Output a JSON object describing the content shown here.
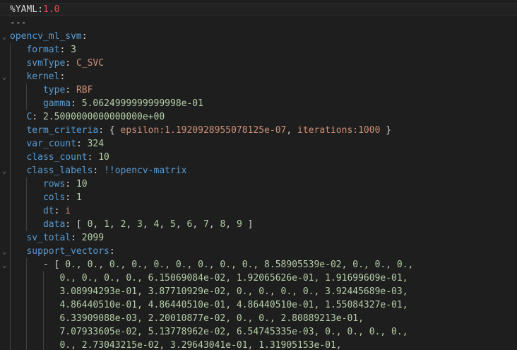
{
  "theme": {
    "background": "#1e1e1e",
    "key": "#569cd6",
    "number": "#b5cea8",
    "string": "#ce9178",
    "version": "#f44747",
    "text": "#d4d4d4"
  },
  "lines": [
    {
      "indent": 0,
      "fold": false,
      "active": true,
      "tokens": [
        {
          "t": "%YAML",
          "c": "directive"
        },
        {
          "t": ":",
          "c": "plain"
        },
        {
          "t": "1.0",
          "c": "version"
        }
      ]
    },
    {
      "indent": 0,
      "fold": false,
      "tokens": [
        {
          "t": "---",
          "c": "plain"
        }
      ]
    },
    {
      "indent": 0,
      "fold": true,
      "tokens": [
        {
          "t": "opencv_ml_svm",
          "c": "key"
        },
        {
          "t": ":",
          "c": "plain"
        }
      ]
    },
    {
      "indent": 1,
      "fold": false,
      "tokens": [
        {
          "t": "format",
          "c": "key"
        },
        {
          "t": ": ",
          "c": "plain"
        },
        {
          "t": "3",
          "c": "num"
        }
      ]
    },
    {
      "indent": 1,
      "fold": false,
      "tokens": [
        {
          "t": "svmType",
          "c": "key"
        },
        {
          "t": ": ",
          "c": "plain"
        },
        {
          "t": "C_SVC",
          "c": "str"
        }
      ]
    },
    {
      "indent": 1,
      "fold": true,
      "tokens": [
        {
          "t": "kernel",
          "c": "key"
        },
        {
          "t": ":",
          "c": "plain"
        }
      ]
    },
    {
      "indent": 2,
      "fold": false,
      "tokens": [
        {
          "t": "type",
          "c": "key"
        },
        {
          "t": ": ",
          "c": "plain"
        },
        {
          "t": "RBF",
          "c": "str"
        }
      ]
    },
    {
      "indent": 2,
      "fold": false,
      "tokens": [
        {
          "t": "gamma",
          "c": "key"
        },
        {
          "t": ": ",
          "c": "plain"
        },
        {
          "t": "5.0624999999999998e-01",
          "c": "num"
        }
      ]
    },
    {
      "indent": 1,
      "fold": false,
      "tokens": [
        {
          "t": "C",
          "c": "key"
        },
        {
          "t": ": ",
          "c": "plain"
        },
        {
          "t": "2.5000000000000000e+00",
          "c": "num"
        }
      ]
    },
    {
      "indent": 1,
      "fold": false,
      "tokens": [
        {
          "t": "term_criteria",
          "c": "key"
        },
        {
          "t": ": { ",
          "c": "plain"
        },
        {
          "t": "epsilon:1.1920928955078125e-07",
          "c": "str"
        },
        {
          "t": ", ",
          "c": "plain"
        },
        {
          "t": "iterations:1000",
          "c": "str"
        },
        {
          "t": " }",
          "c": "plain"
        }
      ]
    },
    {
      "indent": 1,
      "fold": false,
      "tokens": [
        {
          "t": "var_count",
          "c": "key"
        },
        {
          "t": ": ",
          "c": "plain"
        },
        {
          "t": "324",
          "c": "num"
        }
      ]
    },
    {
      "indent": 1,
      "fold": false,
      "tokens": [
        {
          "t": "class_count",
          "c": "key"
        },
        {
          "t": ": ",
          "c": "plain"
        },
        {
          "t": "10",
          "c": "num"
        }
      ]
    },
    {
      "indent": 1,
      "fold": true,
      "tokens": [
        {
          "t": "class_labels",
          "c": "key"
        },
        {
          "t": ": ",
          "c": "plain"
        },
        {
          "t": "!!opencv-matrix",
          "c": "tag"
        }
      ]
    },
    {
      "indent": 2,
      "fold": false,
      "tokens": [
        {
          "t": "rows",
          "c": "key"
        },
        {
          "t": ": ",
          "c": "plain"
        },
        {
          "t": "10",
          "c": "num"
        }
      ]
    },
    {
      "indent": 2,
      "fold": false,
      "tokens": [
        {
          "t": "cols",
          "c": "key"
        },
        {
          "t": ": ",
          "c": "plain"
        },
        {
          "t": "1",
          "c": "num"
        }
      ]
    },
    {
      "indent": 2,
      "fold": false,
      "tokens": [
        {
          "t": "dt",
          "c": "key"
        },
        {
          "t": ": ",
          "c": "plain"
        },
        {
          "t": "i",
          "c": "str"
        }
      ]
    },
    {
      "indent": 2,
      "fold": false,
      "tokens": [
        {
          "t": "data",
          "c": "key"
        },
        {
          "t": ": [ ",
          "c": "plain"
        },
        {
          "t": "0",
          "c": "num"
        },
        {
          "t": ", ",
          "c": "plain"
        },
        {
          "t": "1",
          "c": "num"
        },
        {
          "t": ", ",
          "c": "plain"
        },
        {
          "t": "2",
          "c": "num"
        },
        {
          "t": ", ",
          "c": "plain"
        },
        {
          "t": "3",
          "c": "num"
        },
        {
          "t": ", ",
          "c": "plain"
        },
        {
          "t": "4",
          "c": "num"
        },
        {
          "t": ", ",
          "c": "plain"
        },
        {
          "t": "5",
          "c": "num"
        },
        {
          "t": ", ",
          "c": "plain"
        },
        {
          "t": "6",
          "c": "num"
        },
        {
          "t": ", ",
          "c": "plain"
        },
        {
          "t": "7",
          "c": "num"
        },
        {
          "t": ", ",
          "c": "plain"
        },
        {
          "t": "8",
          "c": "num"
        },
        {
          "t": ", ",
          "c": "plain"
        },
        {
          "t": "9",
          "c": "num"
        },
        {
          "t": " ]",
          "c": "plain"
        }
      ]
    },
    {
      "indent": 1,
      "fold": false,
      "tokens": [
        {
          "t": "sv_total",
          "c": "key"
        },
        {
          "t": ": ",
          "c": "plain"
        },
        {
          "t": "2099",
          "c": "num"
        }
      ]
    },
    {
      "indent": 1,
      "fold": true,
      "tokens": [
        {
          "t": "support_vectors",
          "c": "key"
        },
        {
          "t": ":",
          "c": "plain"
        }
      ]
    },
    {
      "indent": 2,
      "fold": true,
      "tokens": [
        {
          "t": "- [ ",
          "c": "plain"
        },
        {
          "t": "0., 0., 0., 0., 0., 0., 0., 0., 0., 8.58905539e-02, 0., 0., 0.,",
          "c": "num"
        }
      ]
    },
    {
      "indent": 3,
      "fold": false,
      "tokens": [
        {
          "t": "0., 0., 0., 0., 6.15069084e-02, 1.92065626e-01, 1.91699609e-01,",
          "c": "num"
        }
      ]
    },
    {
      "indent": 3,
      "fold": false,
      "tokens": [
        {
          "t": "3.08994293e-01, 3.87710929e-02, 0., 0., 0., 0., 3.92445689e-03,",
          "c": "num"
        }
      ]
    },
    {
      "indent": 3,
      "fold": false,
      "tokens": [
        {
          "t": "4.86440510e-01, 4.86440510e-01, 4.86440510e-01, 1.55084327e-01,",
          "c": "num"
        }
      ]
    },
    {
      "indent": 3,
      "fold": false,
      "tokens": [
        {
          "t": "6.33909088e-03, 2.20010877e-02, 0., 0., 2.80889213e-01,",
          "c": "num"
        }
      ]
    },
    {
      "indent": 3,
      "fold": false,
      "tokens": [
        {
          "t": "7.07933605e-02, 5.13778962e-02, 6.54745335e-03, 0., 0., 0., 0.,",
          "c": "num"
        }
      ]
    },
    {
      "indent": 3,
      "fold": false,
      "tokens": [
        {
          "t": "0., 2.73043215e-02, 3.29643041e-01, 1.31905153e-01,",
          "c": "num"
        }
      ]
    }
  ]
}
